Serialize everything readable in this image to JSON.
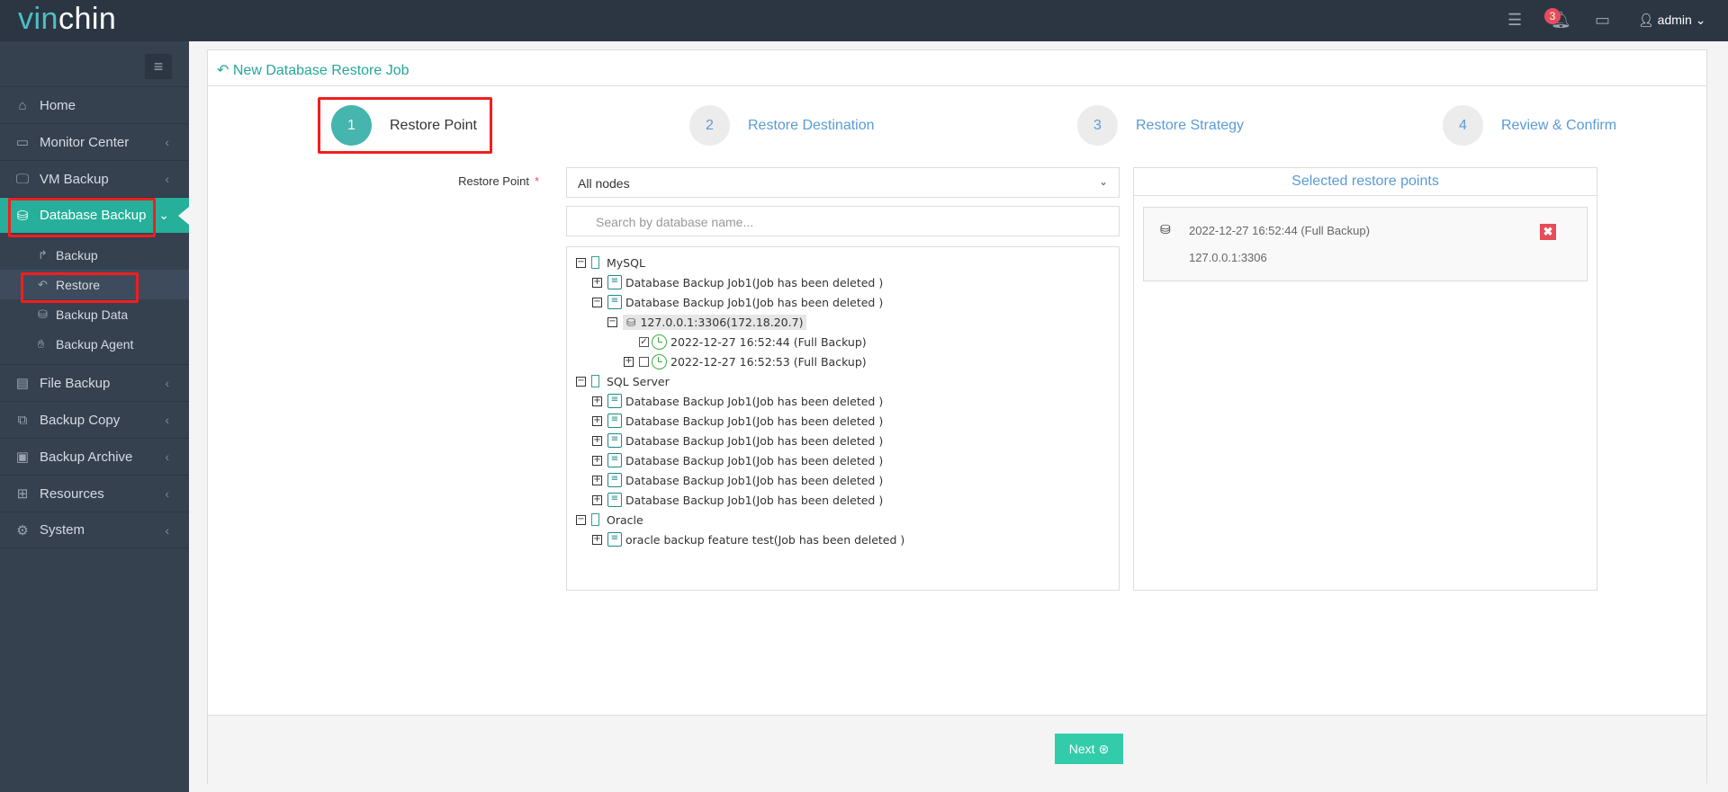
{
  "header": {
    "logo": "vinchin",
    "logo_prefix": "vin",
    "logo_suffix": "chin",
    "notification_count": "3",
    "user": "admin"
  },
  "sidebar": {
    "items": [
      {
        "label": "Home",
        "icon": "home-icon"
      },
      {
        "label": "Monitor Center",
        "icon": "monitor-icon"
      },
      {
        "label": "VM Backup",
        "icon": "desktop-icon"
      },
      {
        "label": "Database Backup",
        "icon": "database-icon",
        "active": true
      },
      {
        "label": "File Backup",
        "icon": "file-icon"
      },
      {
        "label": "Backup Copy",
        "icon": "copy-icon"
      },
      {
        "label": "Backup Archive",
        "icon": "archive-icon"
      },
      {
        "label": "Resources",
        "icon": "resources-icon"
      },
      {
        "label": "System",
        "icon": "gear-icon"
      }
    ],
    "subitems": [
      {
        "label": "Backup"
      },
      {
        "label": "Restore",
        "selected": true
      },
      {
        "label": "Backup Data"
      },
      {
        "label": "Backup Agent"
      }
    ]
  },
  "page": {
    "title": "New Database Restore Job"
  },
  "steps": [
    {
      "num": "1",
      "label": "Restore Point",
      "current": true
    },
    {
      "num": "2",
      "label": "Restore Destination"
    },
    {
      "num": "3",
      "label": "Restore Strategy"
    },
    {
      "num": "4",
      "label": "Review & Confirm"
    }
  ],
  "form": {
    "label": "Restore Point",
    "required": "*",
    "select_value": "All nodes",
    "search_placeholder": "Search by database name..."
  },
  "tree": {
    "mysql": "MySQL",
    "job": "Database Backup Job1(Job has been deleted )",
    "instance": "127.0.0.1:3306(172.18.20.7)",
    "point1": "2022-12-27 16:52:44 (Full Backup)",
    "point2": "2022-12-27 16:52:53 (Full Backup)",
    "sqlserver": "SQL Server",
    "oracle": "Oracle",
    "oracle_job": "oracle backup feature test(Job has been deleted )"
  },
  "selected": {
    "title": "Selected restore points",
    "items": [
      {
        "time": "2022-12-27 16:52:44 (Full Backup)",
        "host": "127.0.0.1:3306"
      }
    ]
  },
  "footer": {
    "next_label": "Next"
  },
  "colors": {
    "accent": "#26b09b",
    "topbar": "#2c3643",
    "sidebar": "#364150",
    "link": "#5b9bd5",
    "danger": "#e84c5a"
  }
}
